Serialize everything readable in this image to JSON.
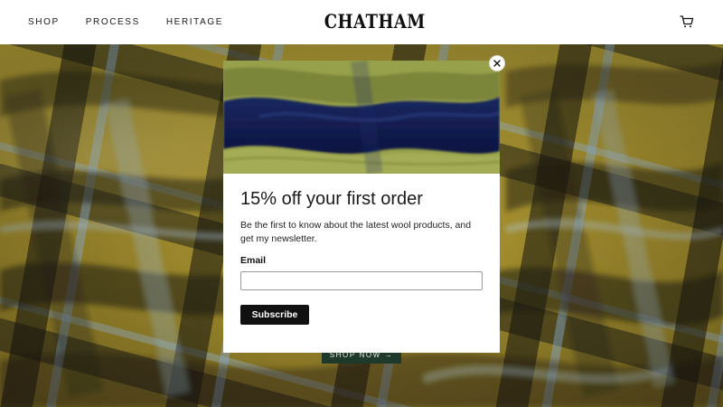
{
  "header": {
    "nav": [
      "SHOP",
      "PROCESS",
      "HERITAGE"
    ],
    "logo": "CHATHAM",
    "cart_icon": "cart-icon"
  },
  "hero": {
    "cta_label": "SHOP NOW →"
  },
  "popup": {
    "title": "15% off your first order",
    "description": "Be the first to know about the latest wool products, and get my newsletter.",
    "email_label": "Email",
    "email_value": "",
    "email_placeholder": "",
    "subscribe_label": "Subscribe",
    "close_icon": "close-icon"
  },
  "colors": {
    "cta_bg": "#1f3a2a",
    "subscribe_bg": "#111111",
    "plaid_yellow": "#b8a43a",
    "plaid_navy": "#0d1a4a"
  }
}
